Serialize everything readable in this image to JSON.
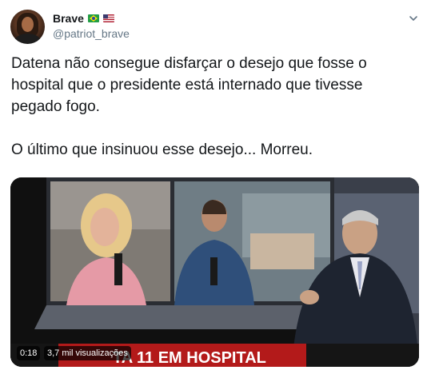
{
  "tweet": {
    "display_name": "Brave",
    "handle": "@patriot_brave",
    "flags": [
      "flag-brazil-icon",
      "flag-usa-icon"
    ],
    "text_paragraphs": [
      "Datena não consegue disfarçar o desejo que fosse o hospital que o presidente está internado que tivesse pegado fogo.",
      "O último que insinuou esse desejo... Morreu."
    ]
  },
  "video": {
    "duration": "0:18",
    "views": "3,7 mil visualizações",
    "lower_third": "TA 11 EM HOSPITAL"
  },
  "colors": {
    "text": "#14171a",
    "secondary": "#657786",
    "lower_third_bar": "#b31a1a"
  }
}
